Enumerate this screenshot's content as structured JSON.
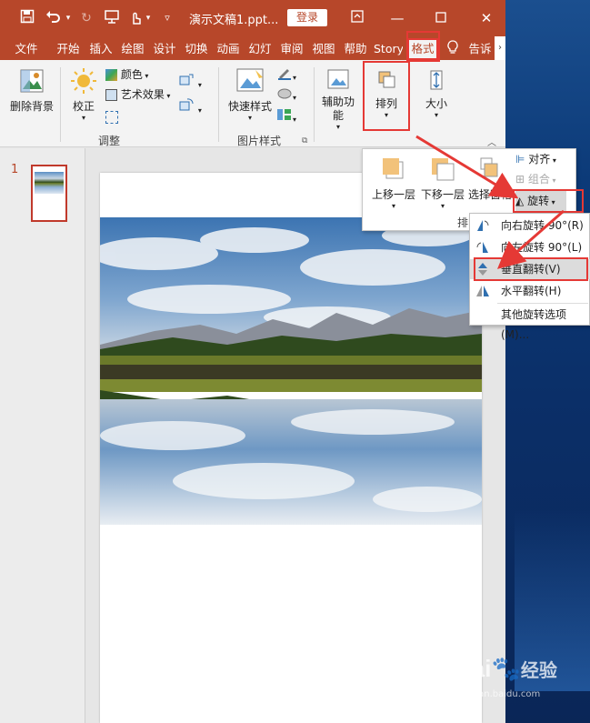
{
  "titlebar": {
    "document_title": "演示文稿1.ppt...",
    "login_label": "登录"
  },
  "tabs": [
    {
      "label": "文件"
    },
    {
      "label": "开始"
    },
    {
      "label": "插入"
    },
    {
      "label": "绘图"
    },
    {
      "label": "设计"
    },
    {
      "label": "切换"
    },
    {
      "label": "动画"
    },
    {
      "label": "幻灯"
    },
    {
      "label": "审阅"
    },
    {
      "label": "视图"
    },
    {
      "label": "帮助"
    },
    {
      "label": "Story"
    },
    {
      "label": "格式"
    },
    {
      "label": "告诉"
    }
  ],
  "ribbon": {
    "remove_background": "删除背景",
    "correct": "校正",
    "color": "颜色",
    "artistic_effects": "艺术效果",
    "adjust_group": "调整",
    "quick_styles": "快速样式",
    "picture_styles_group": "图片样式",
    "accessibility": "辅助功能",
    "arrange": "排列",
    "size": "大小"
  },
  "arrange_panel": {
    "bring_forward": "上移一层",
    "send_backward": "下移一层",
    "selection_pane": "选择窗格",
    "align": "对齐",
    "group": "组合",
    "rotate": "旋转",
    "group_label": "排"
  },
  "rotate_menu": {
    "items": [
      {
        "label": "向右旋转 90°(R)"
      },
      {
        "label": "向左旋转 90°(L)"
      },
      {
        "label": "垂直翻转(V)"
      },
      {
        "label": "水平翻转(H)"
      },
      {
        "label": "其他旋转选项(M)..."
      }
    ]
  },
  "thumbnails": {
    "slide_number": "1"
  },
  "watermark": {
    "brand": "Bai",
    "brand_cn": "经验",
    "url": "jingyan.baidu.com"
  },
  "colors": {
    "accent": "#b7472a",
    "highlight_box": "#e53935"
  }
}
